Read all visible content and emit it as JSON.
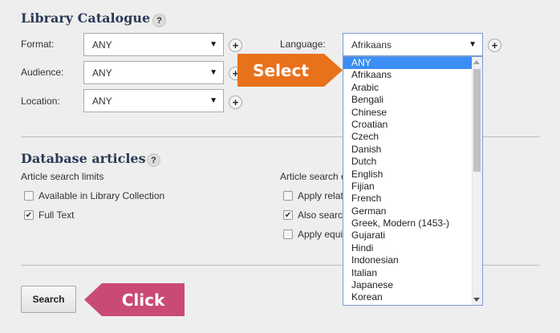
{
  "library": {
    "title": "Library Catalogue",
    "help": "?",
    "format": {
      "label": "Format:",
      "value": "ANY"
    },
    "audience": {
      "label": "Audience:",
      "value": "ANY"
    },
    "location": {
      "label": "Location:",
      "value": "ANY"
    },
    "language": {
      "label": "Language:",
      "value": "Afrikaans",
      "options": [
        "ANY",
        "Afrikaans",
        "Arabic",
        "Bengali",
        "Chinese",
        "Croatian",
        "Czech",
        "Danish",
        "Dutch",
        "English",
        "Fijian",
        "French",
        "German",
        "Greek, Modern (1453-)",
        "Gujarati",
        "Hindi",
        "Indonesian",
        "Italian",
        "Japanese",
        "Korean"
      ],
      "highlighted_option": "ANY"
    },
    "plus": "+",
    "caret": "▼"
  },
  "database": {
    "title": "Database articles",
    "help": "?",
    "limits_label": "Article search limits",
    "options_label": "Article search e",
    "checkboxes_left": [
      {
        "label": "Available in Library Collection",
        "checked": false
      },
      {
        "label": "Full Text",
        "checked": true
      }
    ],
    "checkboxes_right": [
      {
        "label": "Apply relate",
        "checked": false
      },
      {
        "label": "Also search",
        "checked": true
      },
      {
        "label": "Apply equiv",
        "checked": false
      }
    ]
  },
  "search_button": "Search",
  "callouts": {
    "select": {
      "text": "Select",
      "color": "#e8711c"
    },
    "click": {
      "text": "Click",
      "color": "#c94b75"
    }
  }
}
